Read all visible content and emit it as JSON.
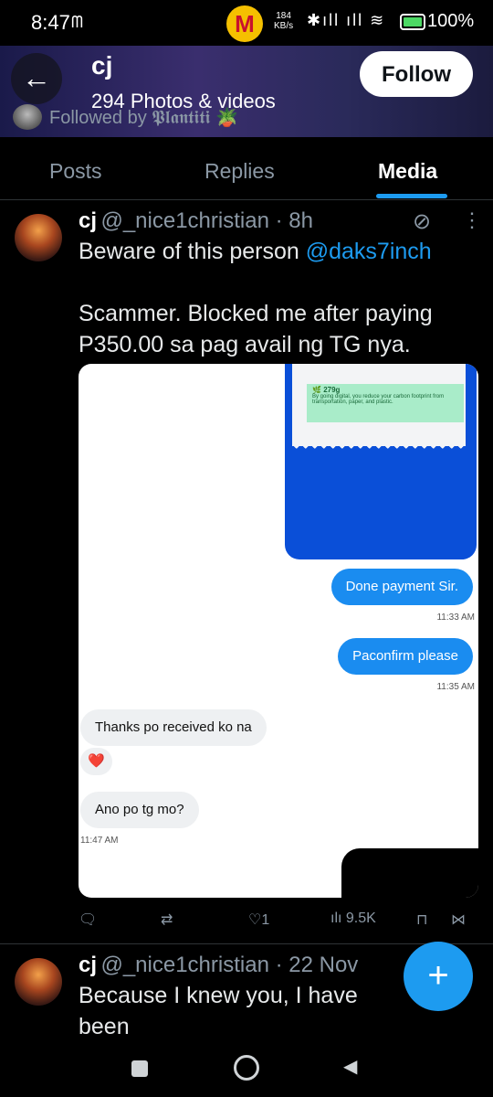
{
  "status_bar": {
    "time": "8:47",
    "carrier_icon": "mcdonalds-icon",
    "net_speed_value": "184",
    "net_speed_unit": "KB/s",
    "battery": "100%"
  },
  "header": {
    "name": "cj",
    "media_count": "294 Photos & videos",
    "follow_label": "Follow",
    "followed_by": "Followed by 𝕻𝖑𝖆𝖓𝖙𝖎𝖙𝖎 🪴"
  },
  "tabs": [
    {
      "label": "Posts"
    },
    {
      "label": "Replies"
    },
    {
      "label": "Media"
    }
  ],
  "tweet1": {
    "name": "cj",
    "handle_time": "@_nice1christian · 8h",
    "text_prefix": "Beware of this person ",
    "mention": "@daks7inch",
    "text_rest": "Scammer. Blocked me after paying\nP350.00 sa pag avail ng TG nya.",
    "media": {
      "eco_title": "279g",
      "eco_text": "By going digital, you reduce your carbon footprint from transportation, paper, and plastic.",
      "messages": [
        {
          "text": "Done payment Sir.",
          "dir": "out",
          "time": "11:33 AM"
        },
        {
          "text": "Paconfirm please",
          "dir": "out",
          "time": "11:35 AM"
        },
        {
          "text": "Thanks po received ko na",
          "dir": "in"
        },
        {
          "text": "❤️",
          "dir": "in"
        },
        {
          "text": "Ano po tg mo?",
          "dir": "in",
          "time": "11:47 AM"
        }
      ]
    },
    "actions": {
      "replies": "",
      "reposts": "",
      "likes": "1",
      "views": "9.5K"
    }
  },
  "tweet2": {
    "name": "cj",
    "handle_time": "@_nice1christian · 22 Nov",
    "text": "Because I knew you, I have been\nchanged FOR GOOD. 💚🩷"
  },
  "fab_label": "+",
  "nav": {
    "recents": "recents-icon",
    "home": "home-icon",
    "back": "back-icon"
  }
}
